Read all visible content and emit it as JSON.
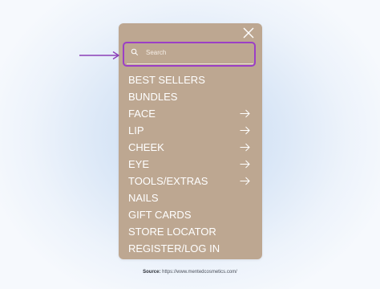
{
  "search": {
    "placeholder": "Search"
  },
  "menu": {
    "items": [
      {
        "label": "BEST SELLERS",
        "has_arrow": false
      },
      {
        "label": "BUNDLES",
        "has_arrow": false
      },
      {
        "label": "FACE",
        "has_arrow": true
      },
      {
        "label": "LIP",
        "has_arrow": true
      },
      {
        "label": "CHEEK",
        "has_arrow": true
      },
      {
        "label": "EYE",
        "has_arrow": true
      },
      {
        "label": "TOOLS/EXTRAS",
        "has_arrow": true
      },
      {
        "label": "NAILS",
        "has_arrow": false
      },
      {
        "label": "GIFT CARDS",
        "has_arrow": false
      },
      {
        "label": "STORE LOCATOR",
        "has_arrow": false
      },
      {
        "label": "REGISTER/LOG IN",
        "has_arrow": false
      }
    ]
  },
  "source": {
    "label": "Source:",
    "url": "https://www.mentedcosmetics.com/"
  },
  "icons": {
    "close": "close-icon",
    "search": "search-icon",
    "submenu": "arrow-right-icon",
    "annotation": "pointer-arrow-icon"
  },
  "colors": {
    "panel": "#bda791",
    "highlight": "#9b3fc6",
    "text": "#ffffff"
  }
}
